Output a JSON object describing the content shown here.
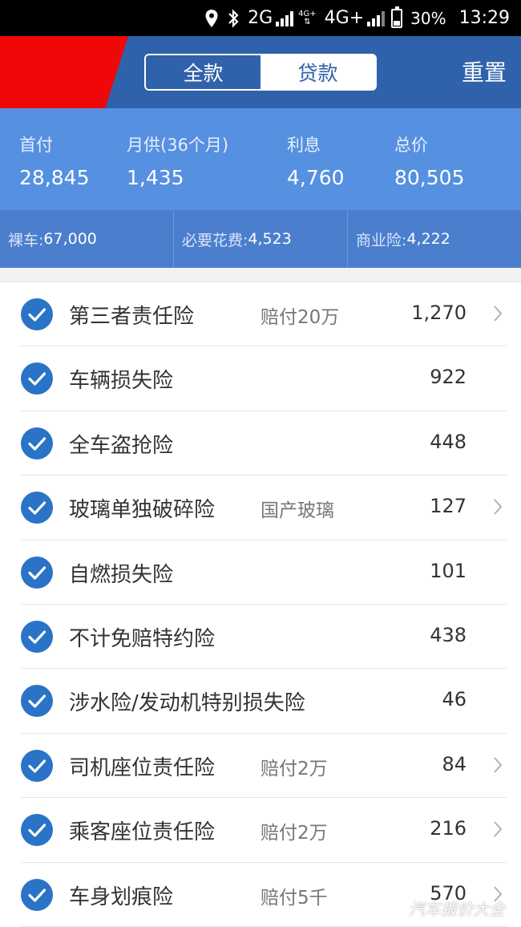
{
  "status_bar": {
    "network1": "2G",
    "network2_small": "4G+",
    "network3": "4G+",
    "battery_percent": "30%",
    "time": "13:29",
    "icons": [
      "location-icon",
      "bluetooth-icon",
      "signal-icon",
      "battery-icon"
    ]
  },
  "header": {
    "tabs": [
      {
        "label": "全款",
        "active": true
      },
      {
        "label": "贷款",
        "active": false
      }
    ],
    "reset_label": "重置",
    "accent_color": "#2f62aa",
    "flag_color": "#f00808"
  },
  "summary": {
    "items": [
      {
        "label": "首付",
        "value": "28,845"
      },
      {
        "label": "月供(36个月)",
        "value": "1,435"
      },
      {
        "label": "利息",
        "value": "4,760"
      },
      {
        "label": "总价",
        "value": "80,505"
      }
    ]
  },
  "breakdown": [
    {
      "label": "裸车: ",
      "value": "67,000"
    },
    {
      "label": "必要花费: ",
      "value": "4,523"
    },
    {
      "label": "商业险: ",
      "value": "4,222"
    }
  ],
  "insurance_items": [
    {
      "name": "第三者责任险",
      "detail": "赔付20万",
      "price": "1,270",
      "has_arrow": true,
      "checked": true
    },
    {
      "name": "车辆损失险",
      "detail": "",
      "price": "922",
      "has_arrow": false,
      "checked": true
    },
    {
      "name": "全车盗抢险",
      "detail": "",
      "price": "448",
      "has_arrow": false,
      "checked": true
    },
    {
      "name": "玻璃单独破碎险",
      "detail": "国产玻璃",
      "price": "127",
      "has_arrow": true,
      "checked": true
    },
    {
      "name": "自燃损失险",
      "detail": "",
      "price": "101",
      "has_arrow": false,
      "checked": true
    },
    {
      "name": "不计免赔特约险",
      "detail": "",
      "price": "438",
      "has_arrow": false,
      "checked": true
    },
    {
      "name": "涉水险/发动机特别损失险",
      "detail": "",
      "price": "46",
      "has_arrow": false,
      "checked": true
    },
    {
      "name": "司机座位责任险",
      "detail": "赔付2万",
      "price": "84",
      "has_arrow": true,
      "checked": true
    },
    {
      "name": "乘客座位责任险",
      "detail": "赔付2万",
      "price": "216",
      "has_arrow": true,
      "checked": true
    },
    {
      "name": "车身划痕险",
      "detail": "赔付5千",
      "price": "570",
      "has_arrow": true,
      "checked": true
    }
  ],
  "watermark": "汽车报价大全"
}
